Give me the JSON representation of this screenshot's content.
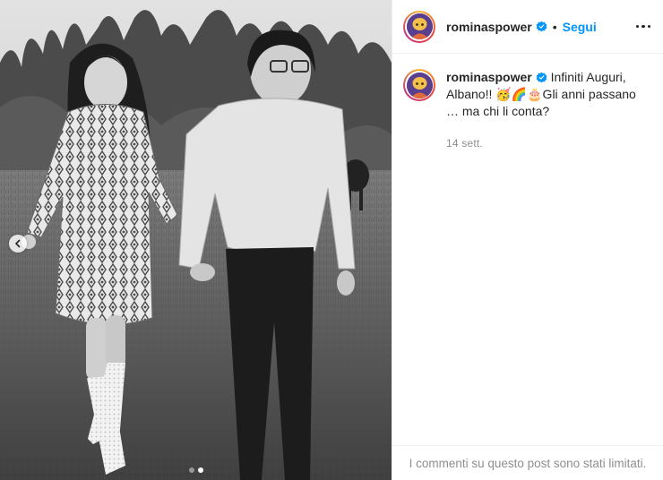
{
  "post": {
    "author": {
      "username": "rominaspower",
      "verified": true
    },
    "follow_label": "Segui",
    "separator": "•",
    "caption": "Infiniti Auguri, Albano!! 🥳🌈🎂Gli anni passano … ma chi li conta?",
    "timestamp": "14 sett.",
    "comments_notice": "I commenti su questo post sono stati limitati."
  },
  "carousel": {
    "slides": 2,
    "active_index": 1
  },
  "icons": {
    "verified": "verified-badge-icon",
    "more": "more-options-icon",
    "prev": "chevron-left-icon"
  },
  "colors": {
    "accent": "#0095f6",
    "text": "#262626",
    "muted": "#8e8e8e",
    "border": "#efefef"
  }
}
